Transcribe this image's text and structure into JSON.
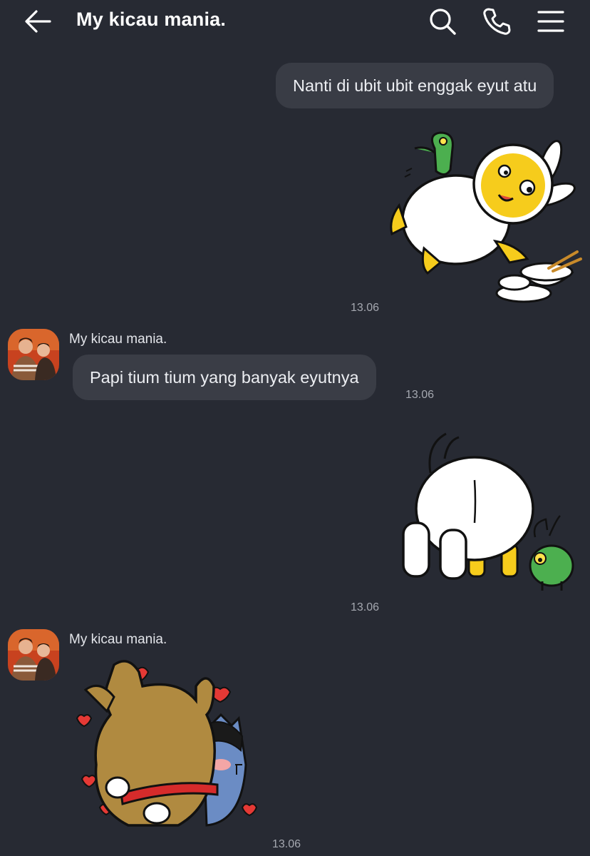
{
  "header": {
    "title": "My kicau mania.",
    "back_icon": "arrow-left-icon",
    "search_icon": "search-icon",
    "call_icon": "phone-icon",
    "menu_icon": "hamburger-menu-icon"
  },
  "messages": [
    {
      "type": "text",
      "direction": "outgoing",
      "text": "Nanti di ubit ubit enggak eyut atu"
    },
    {
      "type": "sticker",
      "direction": "outgoing",
      "sticker": "yellow-dog-bunny-with-green-dino-sticker",
      "time": "13.06"
    },
    {
      "type": "text",
      "direction": "incoming",
      "sender": "My kicau mania.",
      "text": "Papi tium tium yang banyak eyutnya",
      "time": "13.06"
    },
    {
      "type": "sticker",
      "direction": "outgoing",
      "sticker": "white-bunny-butt-with-green-bug-sticker",
      "time": "13.06"
    },
    {
      "type": "sticker",
      "direction": "incoming",
      "sender": "My kicau mania.",
      "sticker": "brown-dog-hugging-blue-cat-hearts-sticker",
      "time": "13.06"
    }
  ],
  "colors": {
    "background": "#272a33",
    "bubble": "#3a3d46",
    "timestamp": "#a5a8b0"
  }
}
